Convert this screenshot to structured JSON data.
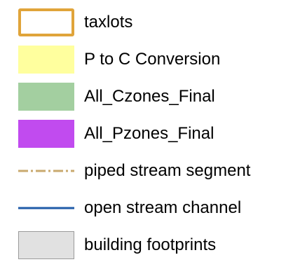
{
  "legend": {
    "items": [
      {
        "label": "taxlots",
        "symbol": "outlined-rectangle",
        "color": "#E0A43A",
        "fill": "#FFFFFF"
      },
      {
        "label": "P to C Conversion",
        "symbol": "filled-rectangle",
        "color": "#FFFF9E"
      },
      {
        "label": "All_Czones_Final",
        "symbol": "filled-rectangle",
        "color": "#A3CFA0"
      },
      {
        "label": "All_Pzones_Final",
        "symbol": "filled-rectangle",
        "color": "#C14BEF"
      },
      {
        "label": "piped stream segment",
        "symbol": "dash-dot-line",
        "color": "#C9A96E"
      },
      {
        "label": "open stream channel",
        "symbol": "solid-line",
        "color": "#1F5BA8"
      },
      {
        "label": "building footprints",
        "symbol": "outlined-rectangle",
        "color": "#9A9A9A",
        "fill": "#E1E1E1"
      }
    ]
  }
}
